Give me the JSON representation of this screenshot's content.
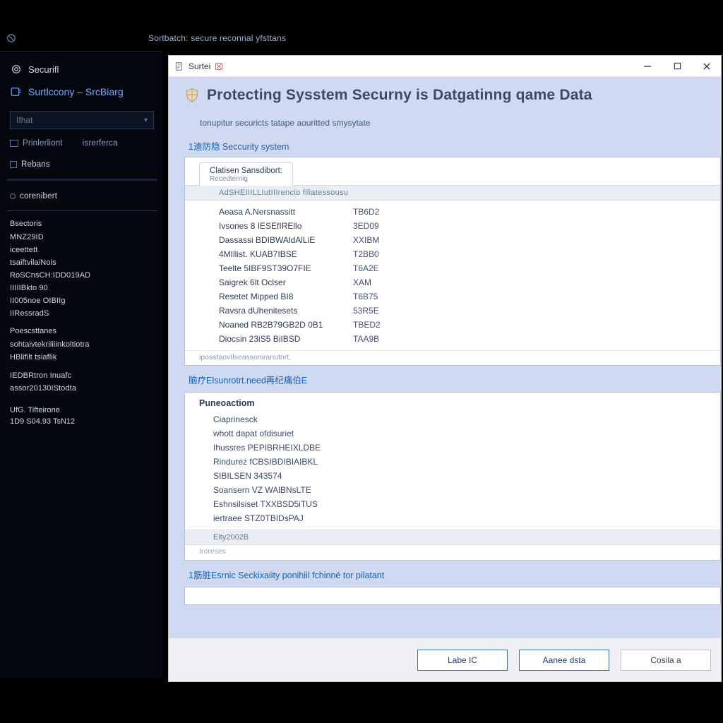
{
  "app_header": {
    "title": "Sortbatch: secure reconnal yfsttans"
  },
  "sidebar": {
    "top_label": "Securifl",
    "category": "Surtlccony – SrcBiarg",
    "search_placeholder": "Ifhat",
    "link_a": "Prinlerliont",
    "link_b": "isrerferca",
    "item_1": "Rebans",
    "item_2": "corenibert",
    "group_a_head": "Bsectoris",
    "group_a": [
      "MNZ29ID",
      "iceettett",
      "tsaiftvilaiNois",
      "RoSCnsCH:IDD019AD",
      "IIIIIBkto 90",
      "II005noe OIBIIg",
      "IIRessradS"
    ],
    "group_b_head": "Poescsttanes",
    "group_b": [
      "sohtaivtekriliiinkoltiotra",
      "HBlifilt tsiaflik"
    ],
    "group_c": [
      "IEDBRtron Inuafc",
      "assor20130IStodta"
    ],
    "meta_a": "UfG. Tifteirone",
    "meta_b": "1D9 S04.93 TsN12"
  },
  "window": {
    "title": "Surtei",
    "heading": "Protecting Sysstem Securny is Datgatinng qame Data",
    "subtitle": "tonupitur securicts tatape aouritted smysytate",
    "section1": {
      "link": "1迪防隐 Seccurity system",
      "tab_label": "Clatisen Sansdibort:",
      "tab_sub": "Recedternig",
      "grid_header": "AdSHEIIILLIutIIIrencio filiatessousu",
      "rows": [
        {
          "k": "Aeasa A.Nersnassitt",
          "v": "TB6D2"
        },
        {
          "k": "Ivsones 8 IESEfIREllo",
          "v": "3ED09"
        },
        {
          "k": "Dassassi BDIBWAldAlLiE",
          "v": "XXIBM"
        },
        {
          "k": "4MIllist. KUAB7IBSE",
          "v": "T2BB0"
        },
        {
          "k": "Teelte 5IBF9ST39O7FIE",
          "v": "T6A2E"
        },
        {
          "k": "Saigrek 6lt Oclser",
          "v": "XAM"
        },
        {
          "k": "Resetet Mipped BI8",
          "v": "T6B75"
        },
        {
          "k": "Ravsra dUhenitesets",
          "v": "53R5E"
        },
        {
          "k": "Noaned RB2B79GB2D 0B1",
          "v": "TBED2"
        },
        {
          "k": "Diocsin 23iS5 BiIBSD",
          "v": "TAA9B"
        }
      ],
      "footnote": "iposstaovIlseassoniranutnrt."
    },
    "section2": {
      "link": "脑疗Elsunrotrt.need再纪痛伯E",
      "head": "Puneoactiom",
      "lines": [
        "Ciaprinesck",
        "whott dapat ofdisuriet",
        "Ihussres PEPIBRHEIXLDBE",
        "Rindurez fCBSIBDIBIAIBKL",
        "SIBILSEN 343574",
        "Soansern VZ WAlBNsLTE",
        "Eshnsilsiset TXXBSD5iTUS",
        "iertraee STZ0TBIDsPAJ"
      ],
      "bar": "Eity2002B",
      "footnote": "Iroreses"
    },
    "section3_link": "1筋脏Esrnic Seckixaiity ponihiil fchinné tor pilatant",
    "buttons": {
      "a": "Labe IC",
      "b": "Aanee dsta",
      "c": "Cosila a"
    }
  }
}
